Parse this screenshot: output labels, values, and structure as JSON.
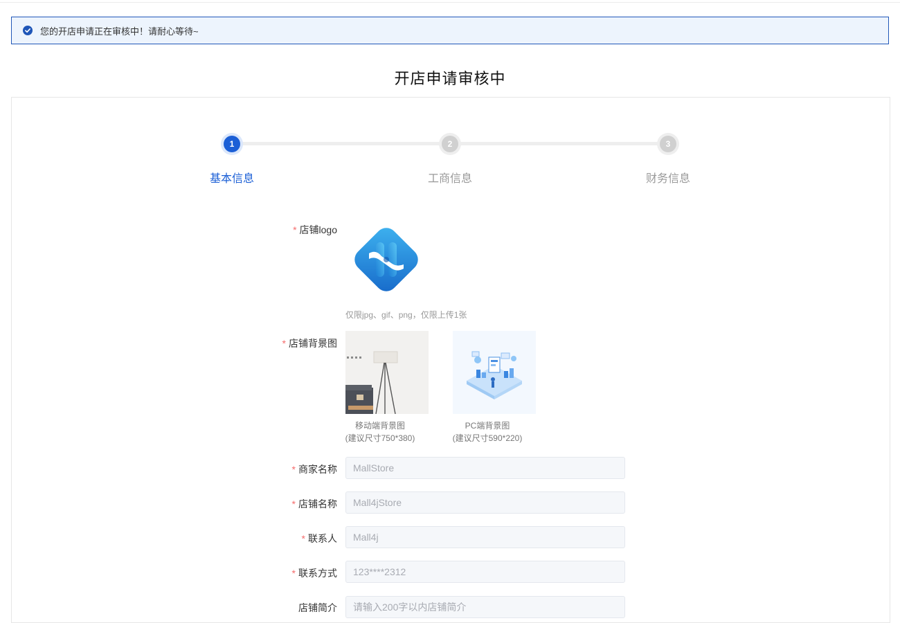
{
  "notice": {
    "text": "您的开店申请正在审核中！请耐心等待~",
    "icon": "check-circle-icon"
  },
  "page_title": "开店申请审核中",
  "steps": [
    {
      "number": "1",
      "label": "基本信息",
      "active": true
    },
    {
      "number": "2",
      "label": "工商信息",
      "active": false
    },
    {
      "number": "3",
      "label": "财务信息",
      "active": false
    }
  ],
  "form": {
    "logo": {
      "label": "店铺logo",
      "required": "*",
      "hint": "仅限jpg、gif、png，仅限上传1张"
    },
    "background": {
      "label": "店铺背景图",
      "required": "*",
      "mobile": {
        "caption": "移动端背景图",
        "size": "(建议尺寸750*380)"
      },
      "pc": {
        "caption": "PC端背景图",
        "size": "(建议尺寸590*220)"
      }
    },
    "merchant_name": {
      "label": "商家名称",
      "required": "*",
      "value": "MallStore"
    },
    "store_name": {
      "label": "店铺名称",
      "required": "*",
      "value": "Mall4jStore"
    },
    "contact": {
      "label": "联系人",
      "required": "*",
      "value": "Mall4j"
    },
    "phone": {
      "label": "联系方式",
      "required": "*",
      "value": "123****2312"
    },
    "intro": {
      "label": "店铺简介",
      "placeholder": "请输入200字以内店铺简介"
    }
  },
  "colors": {
    "accent": "#1b5fd6",
    "required": "#f56c6c",
    "notice_bg": "#edf4fd"
  }
}
